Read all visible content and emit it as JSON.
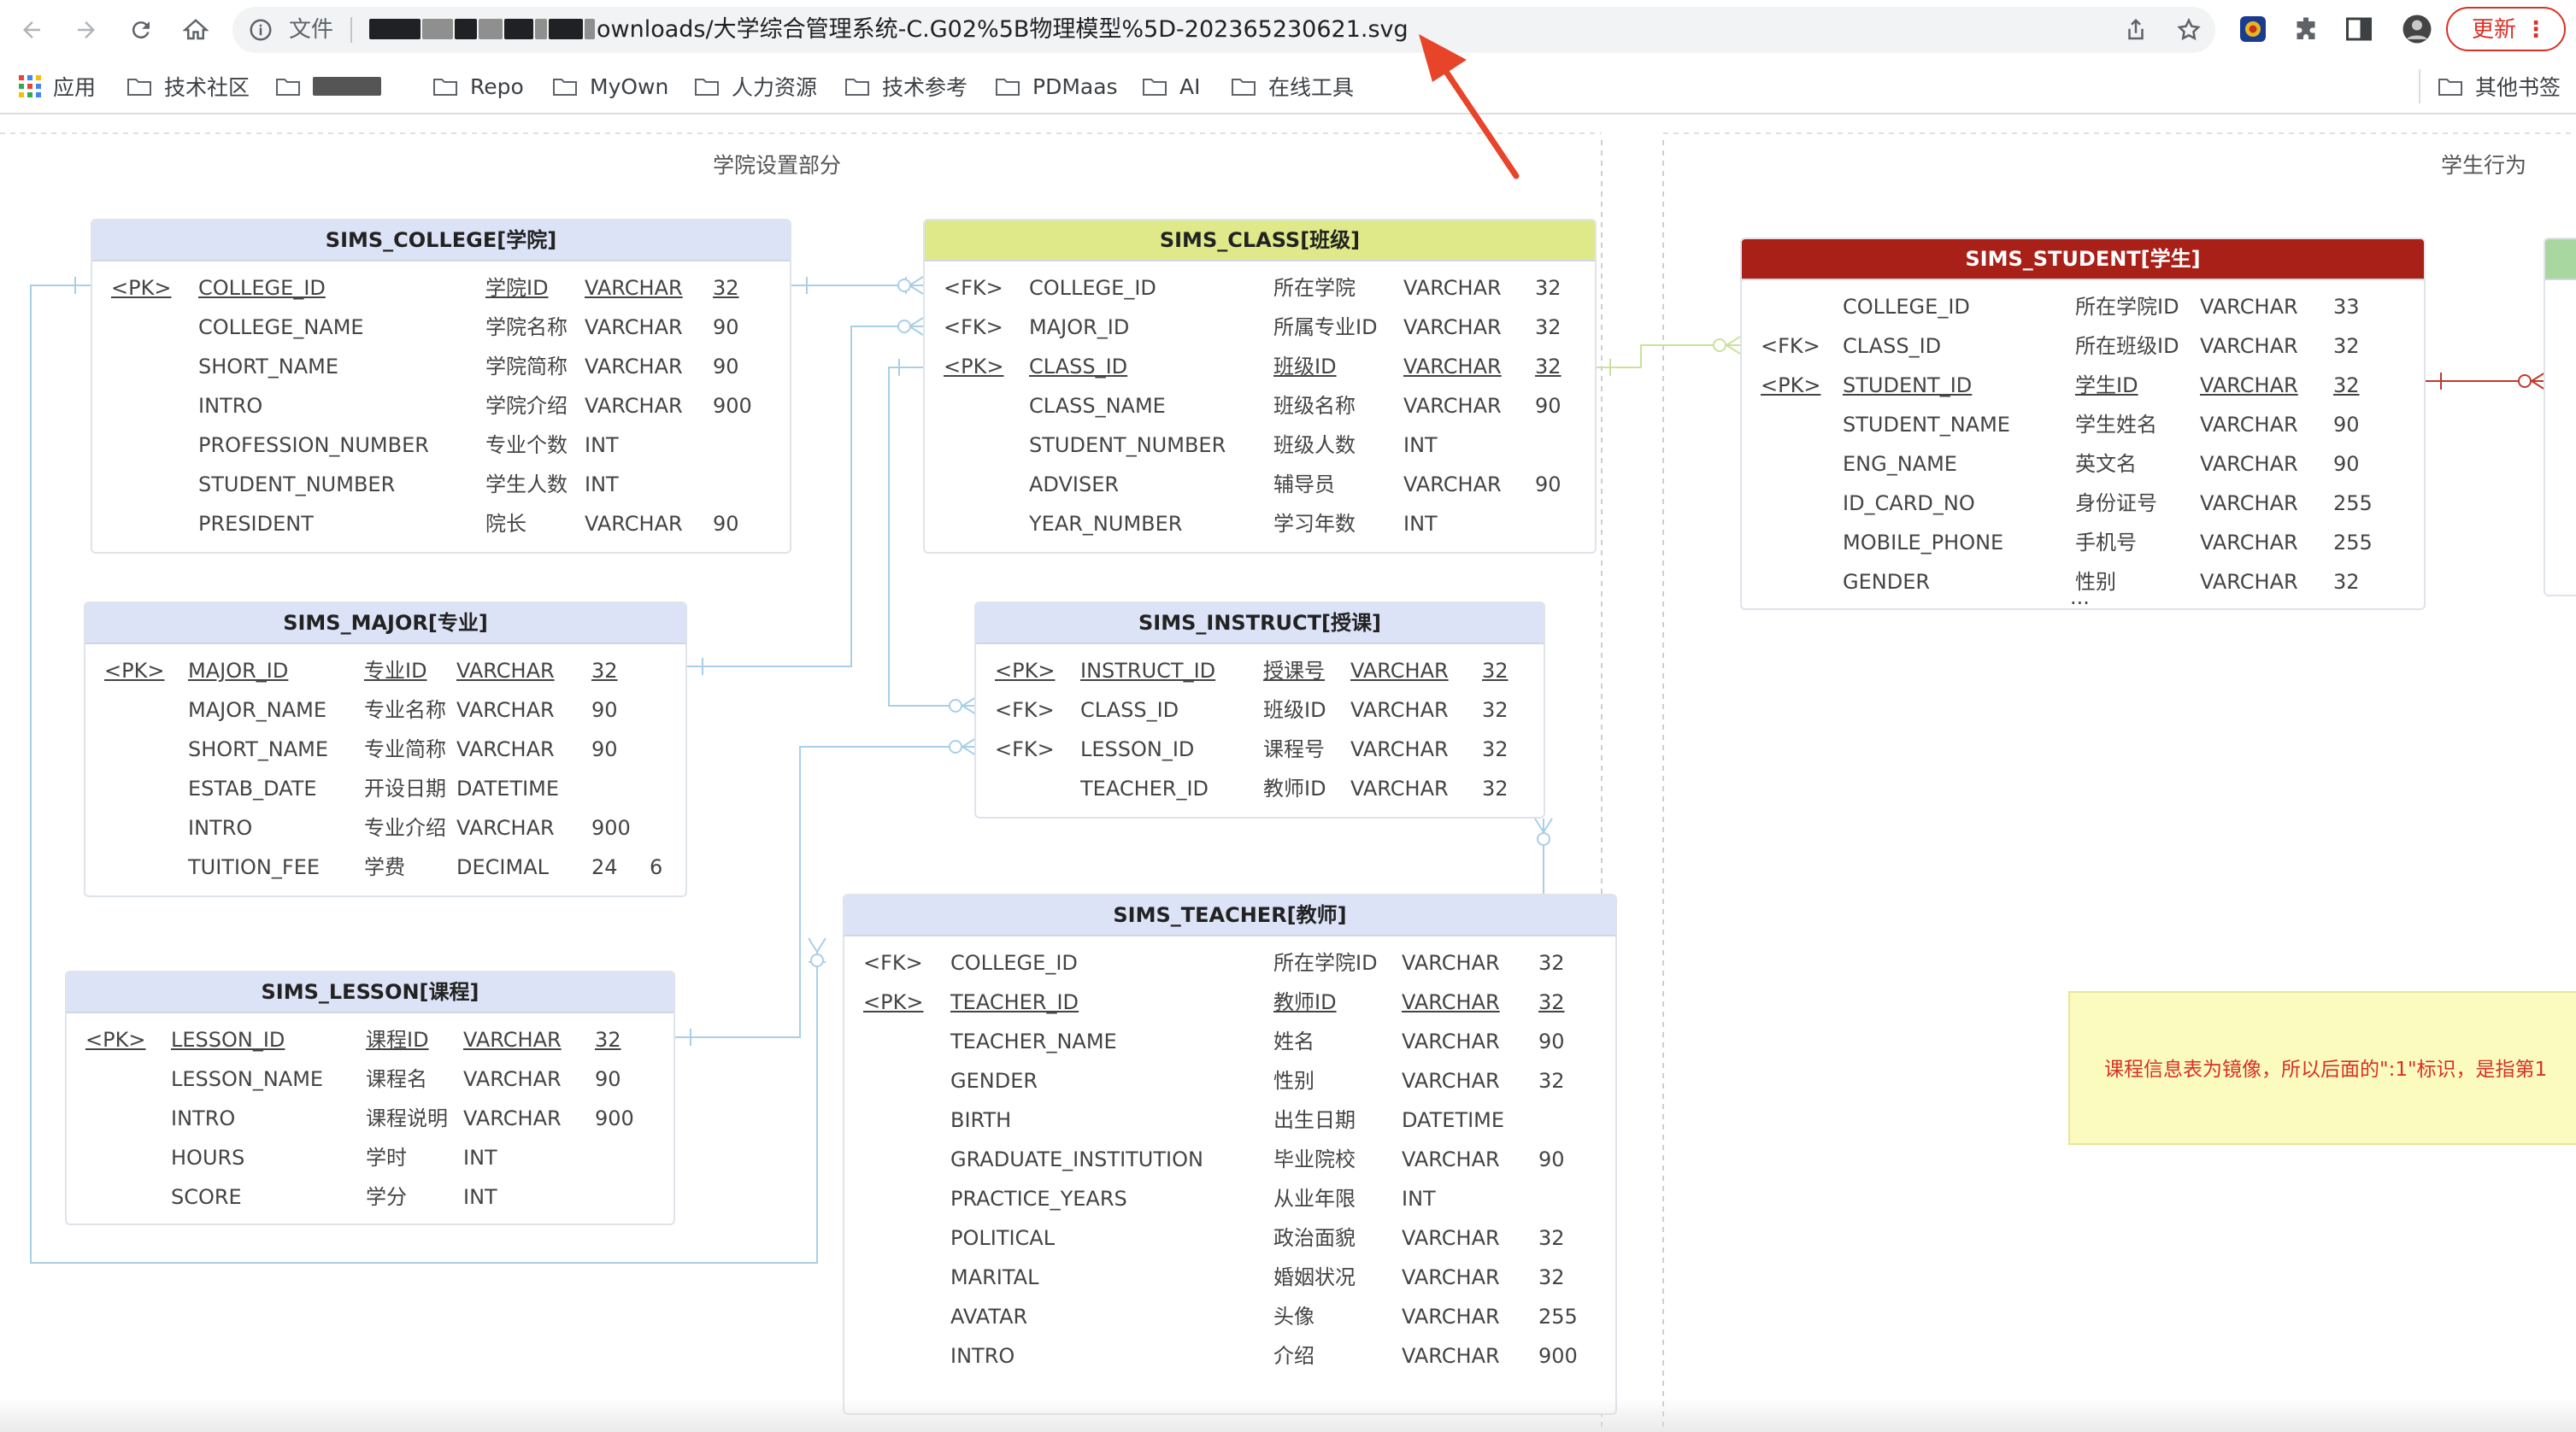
{
  "browser": {
    "omnibox": {
      "label": "文件",
      "url_visible": "ownloads/大学综合管理系统-C.G02%5B物理模型%5D-202365230621.svg"
    },
    "update_button": "更新",
    "bookmarks": [
      {
        "label": "应用"
      },
      {
        "label": "技术社区"
      },
      {
        "label": ""
      },
      {
        "label": "Repo"
      },
      {
        "label": "MyOwn"
      },
      {
        "label": "人力资源"
      },
      {
        "label": "技术参考"
      },
      {
        "label": "PDMaas"
      },
      {
        "label": "AI"
      },
      {
        "label": "在线工具"
      }
    ],
    "other_bookmarks": "其他书签",
    "colors": {
      "update": "#d93025",
      "arrow": "#e8442a"
    }
  },
  "diagram": {
    "groups": [
      "学院设置部分",
      "学生行为"
    ],
    "note": "课程信息表为镜像，所以后面的\":1\"标识，是指第1",
    "entities": {
      "college": {
        "title": "SIMS_COLLEGE[学院]",
        "rows": [
          {
            "key": "<PK>",
            "name": "COLLEGE_ID",
            "cn": "学院ID",
            "type": "VARCHAR",
            "len": "32"
          },
          {
            "key": "",
            "name": "COLLEGE_NAME",
            "cn": "学院名称",
            "type": "VARCHAR",
            "len": "90"
          },
          {
            "key": "",
            "name": "SHORT_NAME",
            "cn": "学院简称",
            "type": "VARCHAR",
            "len": "90"
          },
          {
            "key": "",
            "name": "INTRO",
            "cn": "学院介绍",
            "type": "VARCHAR",
            "len": "900"
          },
          {
            "key": "",
            "name": "PROFESSION_NUMBER",
            "cn": "专业个数",
            "type": "INT",
            "len": ""
          },
          {
            "key": "",
            "name": "STUDENT_NUMBER",
            "cn": "学生人数",
            "type": "INT",
            "len": ""
          },
          {
            "key": "",
            "name": "PRESIDENT",
            "cn": "院长",
            "type": "VARCHAR",
            "len": "90"
          }
        ]
      },
      "class": {
        "title": "SIMS_CLASS[班级]",
        "rows": [
          {
            "key": "<FK>",
            "name": "COLLEGE_ID",
            "cn": "所在学院",
            "type": "VARCHAR",
            "len": "32"
          },
          {
            "key": "<FK>",
            "name": "MAJOR_ID",
            "cn": "所属专业ID",
            "type": "VARCHAR",
            "len": "32"
          },
          {
            "key": "<PK>",
            "name": "CLASS_ID",
            "cn": "班级ID",
            "type": "VARCHAR",
            "len": "32"
          },
          {
            "key": "",
            "name": "CLASS_NAME",
            "cn": "班级名称",
            "type": "VARCHAR",
            "len": "90"
          },
          {
            "key": "",
            "name": "STUDENT_NUMBER",
            "cn": "班级人数",
            "type": "INT",
            "len": ""
          },
          {
            "key": "",
            "name": "ADVISER",
            "cn": "辅导员",
            "type": "VARCHAR",
            "len": "90"
          },
          {
            "key": "",
            "name": "YEAR_NUMBER",
            "cn": "学习年数",
            "type": "INT",
            "len": ""
          }
        ]
      },
      "student": {
        "title": "SIMS_STUDENT[学生]",
        "rows": [
          {
            "key": "",
            "name": "COLLEGE_ID",
            "cn": "所在学院ID",
            "type": "VARCHAR",
            "len": "33"
          },
          {
            "key": "<FK>",
            "name": "CLASS_ID",
            "cn": "所在班级ID",
            "type": "VARCHAR",
            "len": "32"
          },
          {
            "key": "<PK>",
            "name": "STUDENT_ID",
            "cn": "学生ID",
            "type": "VARCHAR",
            "len": "32"
          },
          {
            "key": "",
            "name": "STUDENT_NAME",
            "cn": "学生姓名",
            "type": "VARCHAR",
            "len": "90"
          },
          {
            "key": "",
            "name": "ENG_NAME",
            "cn": "英文名",
            "type": "VARCHAR",
            "len": "90"
          },
          {
            "key": "",
            "name": "ID_CARD_NO",
            "cn": "身份证号",
            "type": "VARCHAR",
            "len": "255"
          },
          {
            "key": "",
            "name": "MOBILE_PHONE",
            "cn": "手机号",
            "type": "VARCHAR",
            "len": "255"
          },
          {
            "key": "",
            "name": "GENDER",
            "cn": "性别",
            "type": "VARCHAR",
            "len": "32"
          }
        ],
        "more": "..."
      },
      "major": {
        "title": "SIMS_MAJOR[专业]",
        "rows": [
          {
            "key": "<PK>",
            "name": "MAJOR_ID",
            "cn": "专业ID",
            "type": "VARCHAR",
            "len": "32",
            "scale": ""
          },
          {
            "key": "",
            "name": "MAJOR_NAME",
            "cn": "专业名称",
            "type": "VARCHAR",
            "len": "90",
            "scale": ""
          },
          {
            "key": "",
            "name": "SHORT_NAME",
            "cn": "专业简称",
            "type": "VARCHAR",
            "len": "90",
            "scale": ""
          },
          {
            "key": "",
            "name": "ESTAB_DATE",
            "cn": "开设日期",
            "type": "DATETIME",
            "len": "",
            "scale": ""
          },
          {
            "key": "",
            "name": "INTRO",
            "cn": "专业介绍",
            "type": "VARCHAR",
            "len": "900",
            "scale": ""
          },
          {
            "key": "",
            "name": "TUITION_FEE",
            "cn": "学费",
            "type": "DECIMAL",
            "len": "24",
            "scale": "6"
          }
        ]
      },
      "instruct": {
        "title": "SIMS_INSTRUCT[授课]",
        "rows": [
          {
            "key": "<PK>",
            "name": "INSTRUCT_ID",
            "cn": "授课号",
            "type": "VARCHAR",
            "len": "32"
          },
          {
            "key": "<FK>",
            "name": "CLASS_ID",
            "cn": "班级ID",
            "type": "VARCHAR",
            "len": "32"
          },
          {
            "key": "<FK>",
            "name": "LESSON_ID",
            "cn": "课程号",
            "type": "VARCHAR",
            "len": "32"
          },
          {
            "key": "",
            "name": "TEACHER_ID",
            "cn": "教师ID",
            "type": "VARCHAR",
            "len": "32"
          }
        ]
      },
      "lesson": {
        "title": "SIMS_LESSON[课程]",
        "rows": [
          {
            "key": "<PK>",
            "name": "LESSON_ID",
            "cn": "课程ID",
            "type": "VARCHAR",
            "len": "32"
          },
          {
            "key": "",
            "name": "LESSON_NAME",
            "cn": "课程名",
            "type": "VARCHAR",
            "len": "90"
          },
          {
            "key": "",
            "name": "INTRO",
            "cn": "课程说明",
            "type": "VARCHAR",
            "len": "900"
          },
          {
            "key": "",
            "name": "HOURS",
            "cn": "学时",
            "type": "INT",
            "len": ""
          },
          {
            "key": "",
            "name": "SCORE",
            "cn": "学分",
            "type": "INT",
            "len": ""
          }
        ]
      },
      "teacher": {
        "title": "SIMS_TEACHER[教师]",
        "rows": [
          {
            "key": "<FK>",
            "name": "COLLEGE_ID",
            "cn": "所在学院ID",
            "type": "VARCHAR",
            "len": "32"
          },
          {
            "key": "<PK>",
            "name": "TEACHER_ID",
            "cn": "教师ID",
            "type": "VARCHAR",
            "len": "32"
          },
          {
            "key": "",
            "name": "TEACHER_NAME",
            "cn": "姓名",
            "type": "VARCHAR",
            "len": "90"
          },
          {
            "key": "",
            "name": "GENDER",
            "cn": "性别",
            "type": "VARCHAR",
            "len": "32"
          },
          {
            "key": "",
            "name": "BIRTH",
            "cn": "出生日期",
            "type": "DATETIME",
            "len": ""
          },
          {
            "key": "",
            "name": "GRADUATE_INSTITUTION",
            "cn": "毕业院校",
            "type": "VARCHAR",
            "len": "90"
          },
          {
            "key": "",
            "name": "PRACTICE_YEARS",
            "cn": "从业年限",
            "type": "INT",
            "len": ""
          },
          {
            "key": "",
            "name": "POLITICAL",
            "cn": "政治面貌",
            "type": "VARCHAR",
            "len": "32"
          },
          {
            "key": "",
            "name": "MARITAL",
            "cn": "婚姻状况",
            "type": "VARCHAR",
            "len": "32"
          },
          {
            "key": "",
            "name": "AVATAR",
            "cn": "头像",
            "type": "VARCHAR",
            "len": "255"
          },
          {
            "key": "",
            "name": "INTRO",
            "cn": "介绍",
            "type": "VARCHAR",
            "len": "900"
          }
        ]
      }
    }
  }
}
